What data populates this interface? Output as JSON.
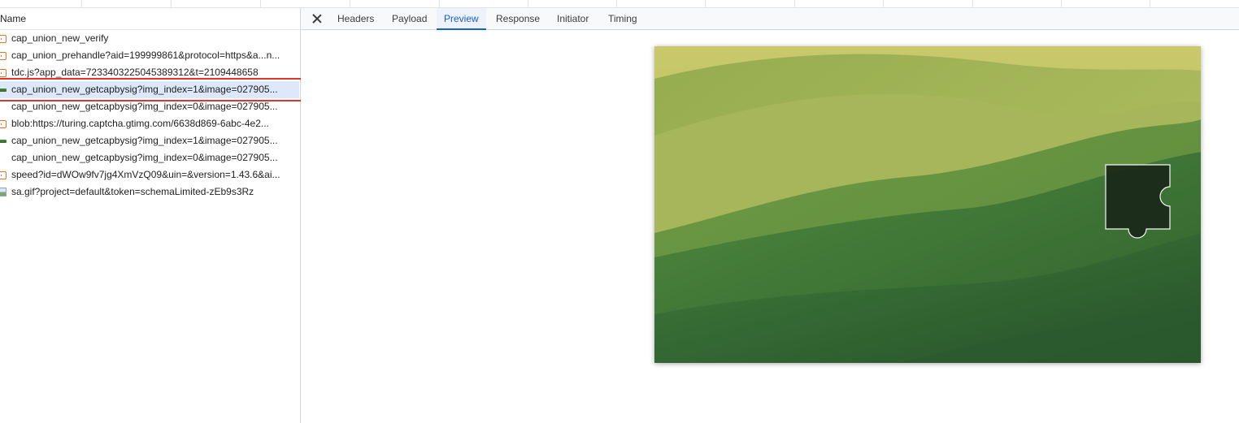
{
  "list": {
    "header": "Name",
    "rows": [
      {
        "name": "cap_union_new_verify",
        "icon": "script-icon"
      },
      {
        "name": "cap_union_prehandle?aid=199999861&protocol=https&a...n...",
        "icon": "script-icon"
      },
      {
        "name": "tdc.js?app_data=7233403225045389312&t=2109448658",
        "icon": "script-icon"
      },
      {
        "name": "cap_union_new_getcapbysig?img_index=1&image=027905...",
        "icon": "image-icon"
      },
      {
        "name": "cap_union_new_getcapbysig?img_index=0&image=027905...",
        "icon": "image-icon"
      },
      {
        "name": "blob:https://turing.captcha.gtimg.com/6638d869-6abc-4e2...",
        "icon": "script-icon"
      },
      {
        "name": "cap_union_new_getcapbysig?img_index=1&image=027905...",
        "icon": "image-icon"
      },
      {
        "name": "cap_union_new_getcapbysig?img_index=0&image=027905...",
        "icon": "image-icon"
      },
      {
        "name": "speed?id=dWOw9fv7jg4XmVzQ09&uin=&version=1.43.6&ai...",
        "icon": "script-icon"
      },
      {
        "name": "sa.gif?project=default&token=schemaLimited-zEb9s3Rz",
        "icon": "gif-image-icon"
      }
    ],
    "selected_index": 3
  },
  "detail": {
    "close_icon": "close-icon",
    "tabs": [
      "Headers",
      "Payload",
      "Preview",
      "Response",
      "Initiator",
      "Timing"
    ],
    "active_tab": "Preview"
  },
  "colors": {
    "accent": "#1a5fd0",
    "highlight_box": "#e5352b",
    "selected_row": "#dde8fb",
    "script_icon": "#e6732b"
  }
}
